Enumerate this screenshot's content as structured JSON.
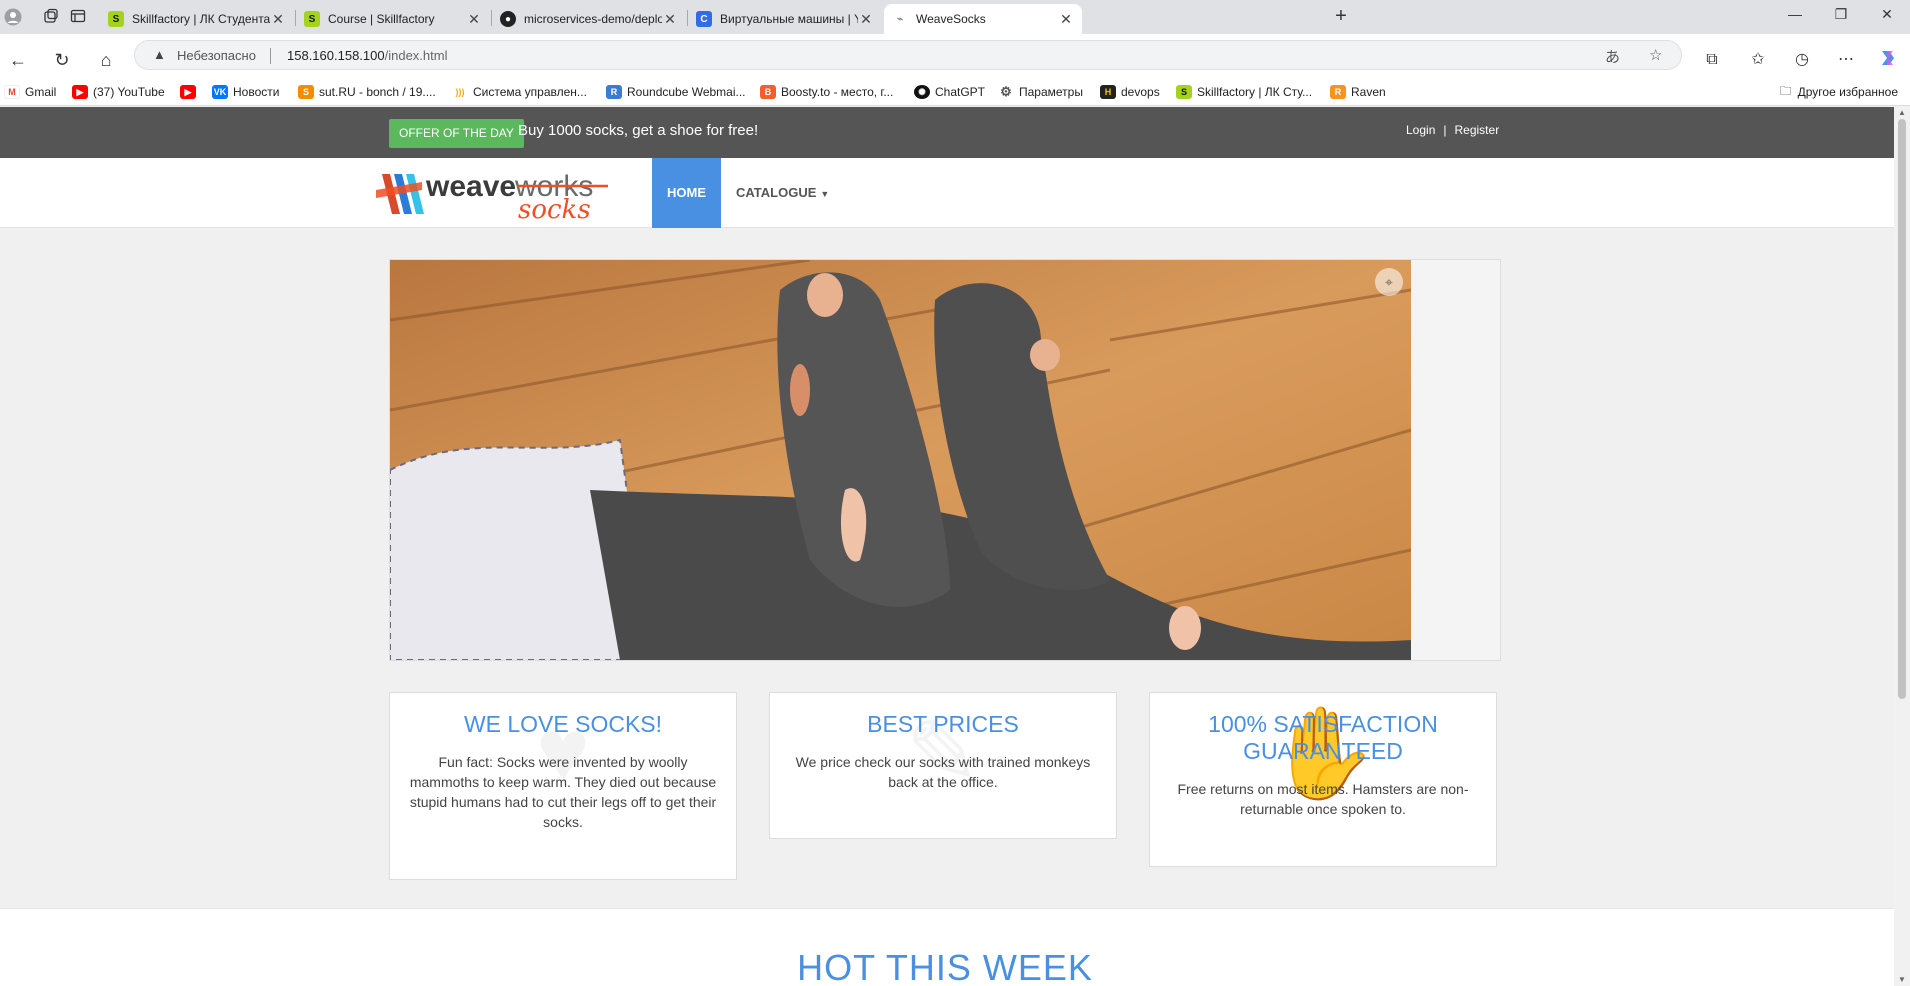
{
  "browser": {
    "tabs": [
      {
        "title": "Skillfactory | ЛК Студента",
        "favicon_color": "#a4d31e",
        "active": false
      },
      {
        "title": "Course | Skillfactory",
        "favicon_color": "#a4d31e",
        "active": false
      },
      {
        "title": "microservices-demo/deploy/dock",
        "favicon_color": "#222222",
        "active": false
      },
      {
        "title": "Виртуальные машины | Yandex C",
        "favicon_color": "#2f6ce5",
        "active": false
      },
      {
        "title": "WeaveSocks",
        "favicon_color": "#ffffff",
        "active": true
      }
    ],
    "address": {
      "security_label": "Небезопасно",
      "url_host": "158.160.158.100",
      "url_path": "/index.html"
    },
    "bookmarks": [
      {
        "label": "Gmail",
        "color": "#ea4335"
      },
      {
        "label": "(37) YouTube",
        "color": "#ff0000"
      },
      {
        "label": "",
        "color": "#ff0000"
      },
      {
        "label": "Новости",
        "color": "#0077ff"
      },
      {
        "label": "sut.RU - bonch / 19....",
        "color": "#f28c00"
      },
      {
        "label": "Система управлен...",
        "color": "#f6a800"
      },
      {
        "label": "Roundcube Webmai...",
        "color": "#3a7bd5"
      },
      {
        "label": "Boosty.to - место, г...",
        "color": "#f15f2c"
      },
      {
        "label": "ChatGPT",
        "color": "#111111"
      },
      {
        "label": "Параметры",
        "color": "#555555"
      },
      {
        "label": "devops",
        "color": "#222222"
      },
      {
        "label": "Skillfactory | ЛК Сту...",
        "color": "#a4d31e"
      },
      {
        "label": "Raven",
        "color": "#f7931e"
      }
    ],
    "other_bookmarks": "Другое избранное"
  },
  "site": {
    "offer_badge": "OFFER OF THE DAY",
    "offer_text": "Buy 1000 socks, get a shoe for free!",
    "login": "Login",
    "separator": "|",
    "register": "Register",
    "nav": {
      "home": "HOME",
      "catalogue": "CATALOGUE"
    },
    "brand_colors": {
      "accent": "#4a90e2",
      "offer": "#5cb85c",
      "topbar": "#555555"
    },
    "features": [
      {
        "title": "WE LOVE SOCKS!",
        "text": "Fun fact: Socks were invented by woolly mammoths to keep warm. They died out because stupid humans had to cut their legs off to get their socks.",
        "icon": "heart-icon"
      },
      {
        "title": "BEST PRICES",
        "text": "We price check our socks with trained monkeys back at the office.",
        "icon": "tag-icon"
      },
      {
        "title": "100% SATISFACTION GUARANTEED",
        "text": "Free returns on most items. Hamsters are non-returnable once spoken to.",
        "icon": "thumbs-up-icon"
      }
    ],
    "hot_title": "HOT THIS WEEK"
  }
}
